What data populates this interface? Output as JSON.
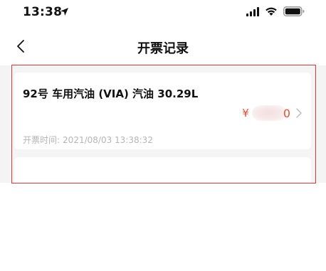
{
  "status_bar": {
    "time": "13:38"
  },
  "nav": {
    "title": "开票记录"
  },
  "records": [
    {
      "title": "92号 车用汽油 (VIA) 汽油 30.29L",
      "currency": "¥",
      "price_visible_tail": "0",
      "time_label": "开票时间:",
      "time_value": "2021/08/03 13:38:32"
    }
  ],
  "colors": {
    "accent_price": "#ee4d33",
    "highlight_border": "#e5373a",
    "list_background": "#f4f4f4",
    "muted_text": "#b5b5b5"
  },
  "icons": {
    "back": "chevron-left-icon",
    "arrow": "chevron-right-icon",
    "location": "location-arrow-icon",
    "signal": "signal-icon",
    "wifi": "wifi-icon",
    "battery": "battery-icon"
  }
}
